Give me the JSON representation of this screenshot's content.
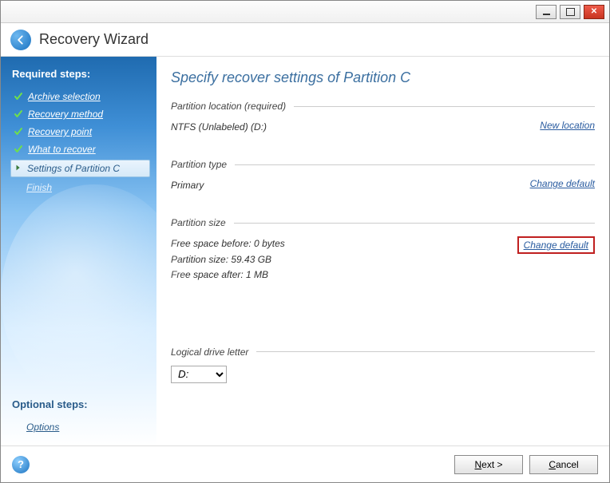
{
  "header": {
    "title": "Recovery Wizard"
  },
  "sidebar": {
    "required_heading": "Required steps:",
    "steps": [
      {
        "label": "Archive selection",
        "state": "done"
      },
      {
        "label": "Recovery method",
        "state": "done"
      },
      {
        "label": "Recovery point",
        "state": "done"
      },
      {
        "label": "What to recover",
        "state": "done"
      },
      {
        "label": "Settings of Partition C",
        "state": "current"
      },
      {
        "label": "Finish",
        "state": "future"
      }
    ],
    "optional_heading": "Optional steps:",
    "optional_link": "Options"
  },
  "main": {
    "title": "Specify recover settings of Partition C",
    "location": {
      "heading": "Partition location (required)",
      "value": "NTFS (Unlabeled) (D:)",
      "link": "New location"
    },
    "type": {
      "heading": "Partition type",
      "value": "Primary",
      "link": "Change default"
    },
    "size": {
      "heading": "Partition size",
      "line1": "Free space before: 0 bytes",
      "line2": "Partition size: 59.43 GB",
      "line3": "Free space after: 1 MB",
      "link": "Change default"
    },
    "drive": {
      "heading": "Logical drive letter",
      "value": "D:"
    }
  },
  "footer": {
    "next": "Next >",
    "cancel": "Cancel"
  }
}
